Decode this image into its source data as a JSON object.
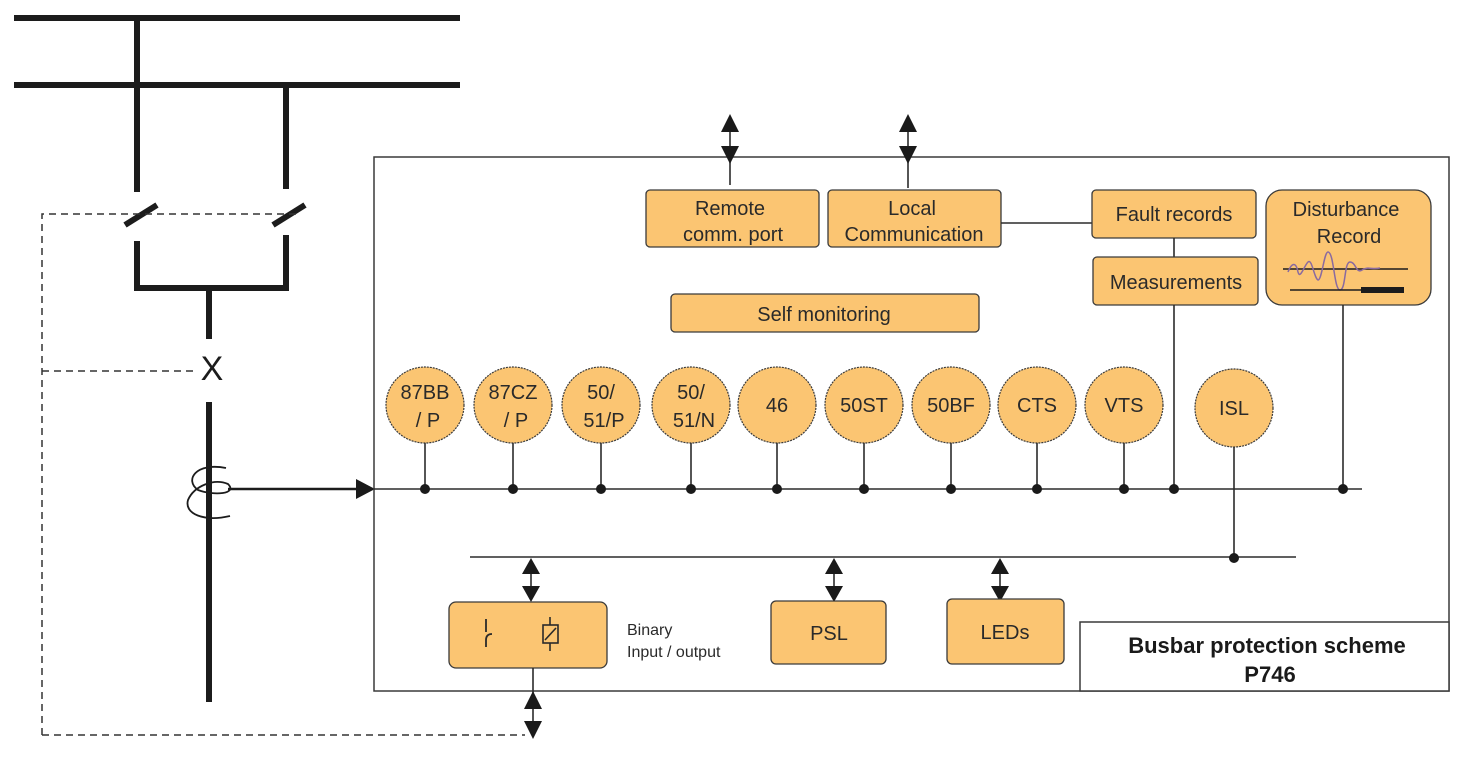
{
  "diagram": {
    "title": "Busbar protection scheme",
    "model": "P746",
    "communication": {
      "remote_line1": "Remote",
      "remote_line2": "comm. port",
      "local_line1": "Local",
      "local_line2": "Communication"
    },
    "records": {
      "fault_records": "Fault records",
      "measurements": "Measurements",
      "disturbance_line1": "Disturbance",
      "disturbance_line2": "Record"
    },
    "self_monitoring": "Self monitoring",
    "protection_functions": [
      {
        "line1": "87BB",
        "line2": "/ P"
      },
      {
        "line1": "87CZ",
        "line2": "/ P"
      },
      {
        "line1": "50/",
        "line2": "51/P"
      },
      {
        "line1": "50/",
        "line2": "51/N"
      },
      {
        "line1": "46",
        "line2": ""
      },
      {
        "line1": "50ST",
        "line2": ""
      },
      {
        "line1": "50BF",
        "line2": ""
      },
      {
        "line1": "CTS",
        "line2": ""
      },
      {
        "line1": "VTS",
        "line2": ""
      }
    ],
    "isl": "ISL",
    "binary_io": {
      "label_line1": "Binary",
      "label_line2": "Input / output"
    },
    "psl": "PSL",
    "leds": "LEDs",
    "breaker_symbol": "X",
    "colors": {
      "block_fill": "#fbc572",
      "line": "#1c1c1c",
      "waveform": "#8a6aa0"
    }
  }
}
